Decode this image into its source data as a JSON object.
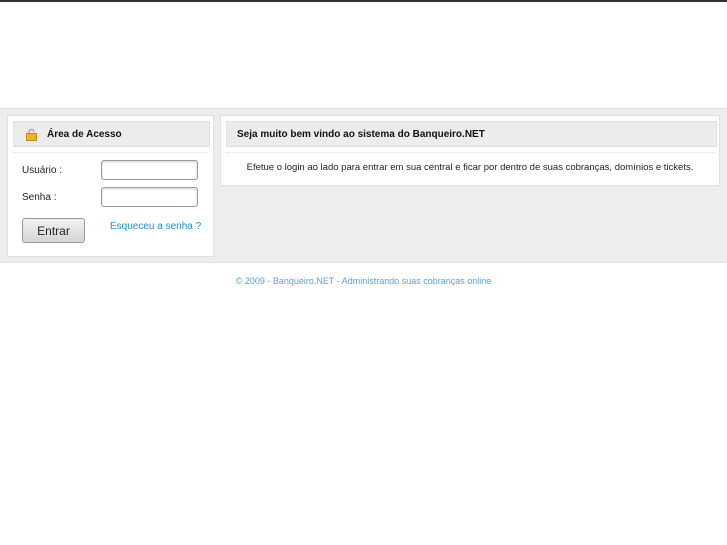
{
  "login": {
    "title": "Área de Acesso",
    "user_label": "Usuário :",
    "pass_label": "Senha :",
    "user_value": "",
    "pass_value": "",
    "submit": "Entrar",
    "forgot": "Esqueceu a senha ?"
  },
  "welcome": {
    "title": "Seja muito bem vindo ao sistema do Banqueiro.NET",
    "text": "Efetue o login ao lado para entrar em sua central e ficar por dentro de suas cobranças, domínios e tickets."
  },
  "footer": {
    "text": "© 2009 - Banqueiro.NET - Administrando suas cobranças online"
  }
}
